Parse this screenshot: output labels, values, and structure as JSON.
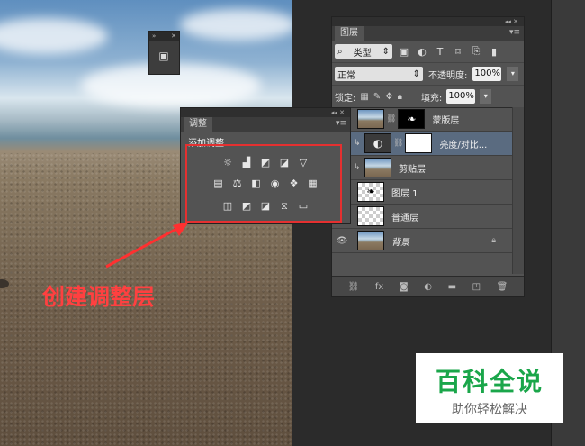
{
  "mini_panel": {
    "collapse": "»",
    "close": "✕"
  },
  "layers_panel": {
    "header": "◂◂ ✕",
    "tab": "图层",
    "menu": "▾≡",
    "filter": {
      "kind": "类型",
      "arrow": "⇕"
    },
    "blend_mode": "正常",
    "opacity_label": "不透明度:",
    "opacity_value": "100%",
    "lock_label": "锁定:",
    "fill_label": "填充:",
    "fill_value": "100%",
    "layers": [
      {
        "name": "蒙版层",
        "visible": false,
        "clipped": false,
        "thumb": "beach",
        "mask": "black"
      },
      {
        "name": "亮度/对比...",
        "visible": false,
        "clipped": true,
        "thumb": "adjust",
        "mask": "white",
        "selected": true
      },
      {
        "name": "剪贴层",
        "visible": false,
        "clipped": true,
        "thumb": "beach"
      },
      {
        "name": "图层 1",
        "visible": false,
        "clipped": false,
        "thumb": "checker"
      },
      {
        "name": "普通层",
        "visible": false,
        "clipped": false,
        "thumb": "checker"
      },
      {
        "name": "背景",
        "visible": true,
        "clipped": false,
        "thumb": "beach",
        "locked": true,
        "italic": true
      }
    ],
    "footer_icons": [
      "link-icon",
      "fx-icon",
      "mask-icon",
      "adjustment-icon",
      "folder-icon",
      "new-layer-icon",
      "trash-icon"
    ]
  },
  "adjust_panel": {
    "header": "◂◂ ✕",
    "tab": "调整",
    "menu": "▾≡",
    "title": "添加调整",
    "icons_row1": [
      "brightness-icon",
      "levels-icon",
      "curves-icon",
      "exposure-icon",
      "triangle-icon"
    ],
    "icons_row2": [
      "vibrance-icon",
      "balance-icon",
      "bw-icon",
      "photo-filter-icon",
      "channel-mixer-icon",
      "lookup-icon"
    ],
    "icons_row3": [
      "invert-icon",
      "posterize-icon",
      "threshold-icon",
      "selective-color-icon",
      "gradient-map-icon"
    ]
  },
  "annotation": {
    "text": "创建调整层",
    "color": "#ff4040"
  },
  "watermark": {
    "title": "百科全说",
    "subtitle": "助你轻松解决",
    "color": "#1aa64a"
  }
}
